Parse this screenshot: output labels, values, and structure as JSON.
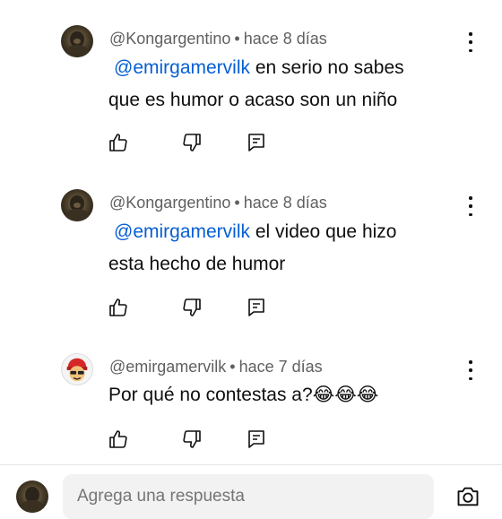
{
  "comments": [
    {
      "author": "@Kongargentino",
      "time": "hace 8 días",
      "mention": "@emirgamervilk",
      "line1_rest": " en serio no sabes",
      "line2": "que es humor o acaso son un niño",
      "avatar": "gorilla-avatar"
    },
    {
      "author": "@Kongargentino",
      "time": "hace 8 días",
      "mention": "@emirgamervilk",
      "line1_rest": " el video que hizo",
      "line2": "esta hecho de humor",
      "avatar": "gorilla-avatar"
    },
    {
      "author": "@emirgamervilk",
      "time": "hace 7 días",
      "text": "Por qué no contestas a?😂😂😂",
      "avatar": "cartoon-avatar"
    }
  ],
  "separator": "•",
  "reply": {
    "placeholder": "Agrega una respuesta"
  },
  "icons": {
    "like": "thumbs-up-icon",
    "dislike": "thumbs-down-icon",
    "reply": "reply-icon",
    "more": "more-vertical-icon",
    "camera": "camera-icon"
  },
  "colors": {
    "mention": "#065fd4",
    "meta": "#606060",
    "text": "#0f0f0f",
    "input_bg": "#f2f2f2"
  }
}
